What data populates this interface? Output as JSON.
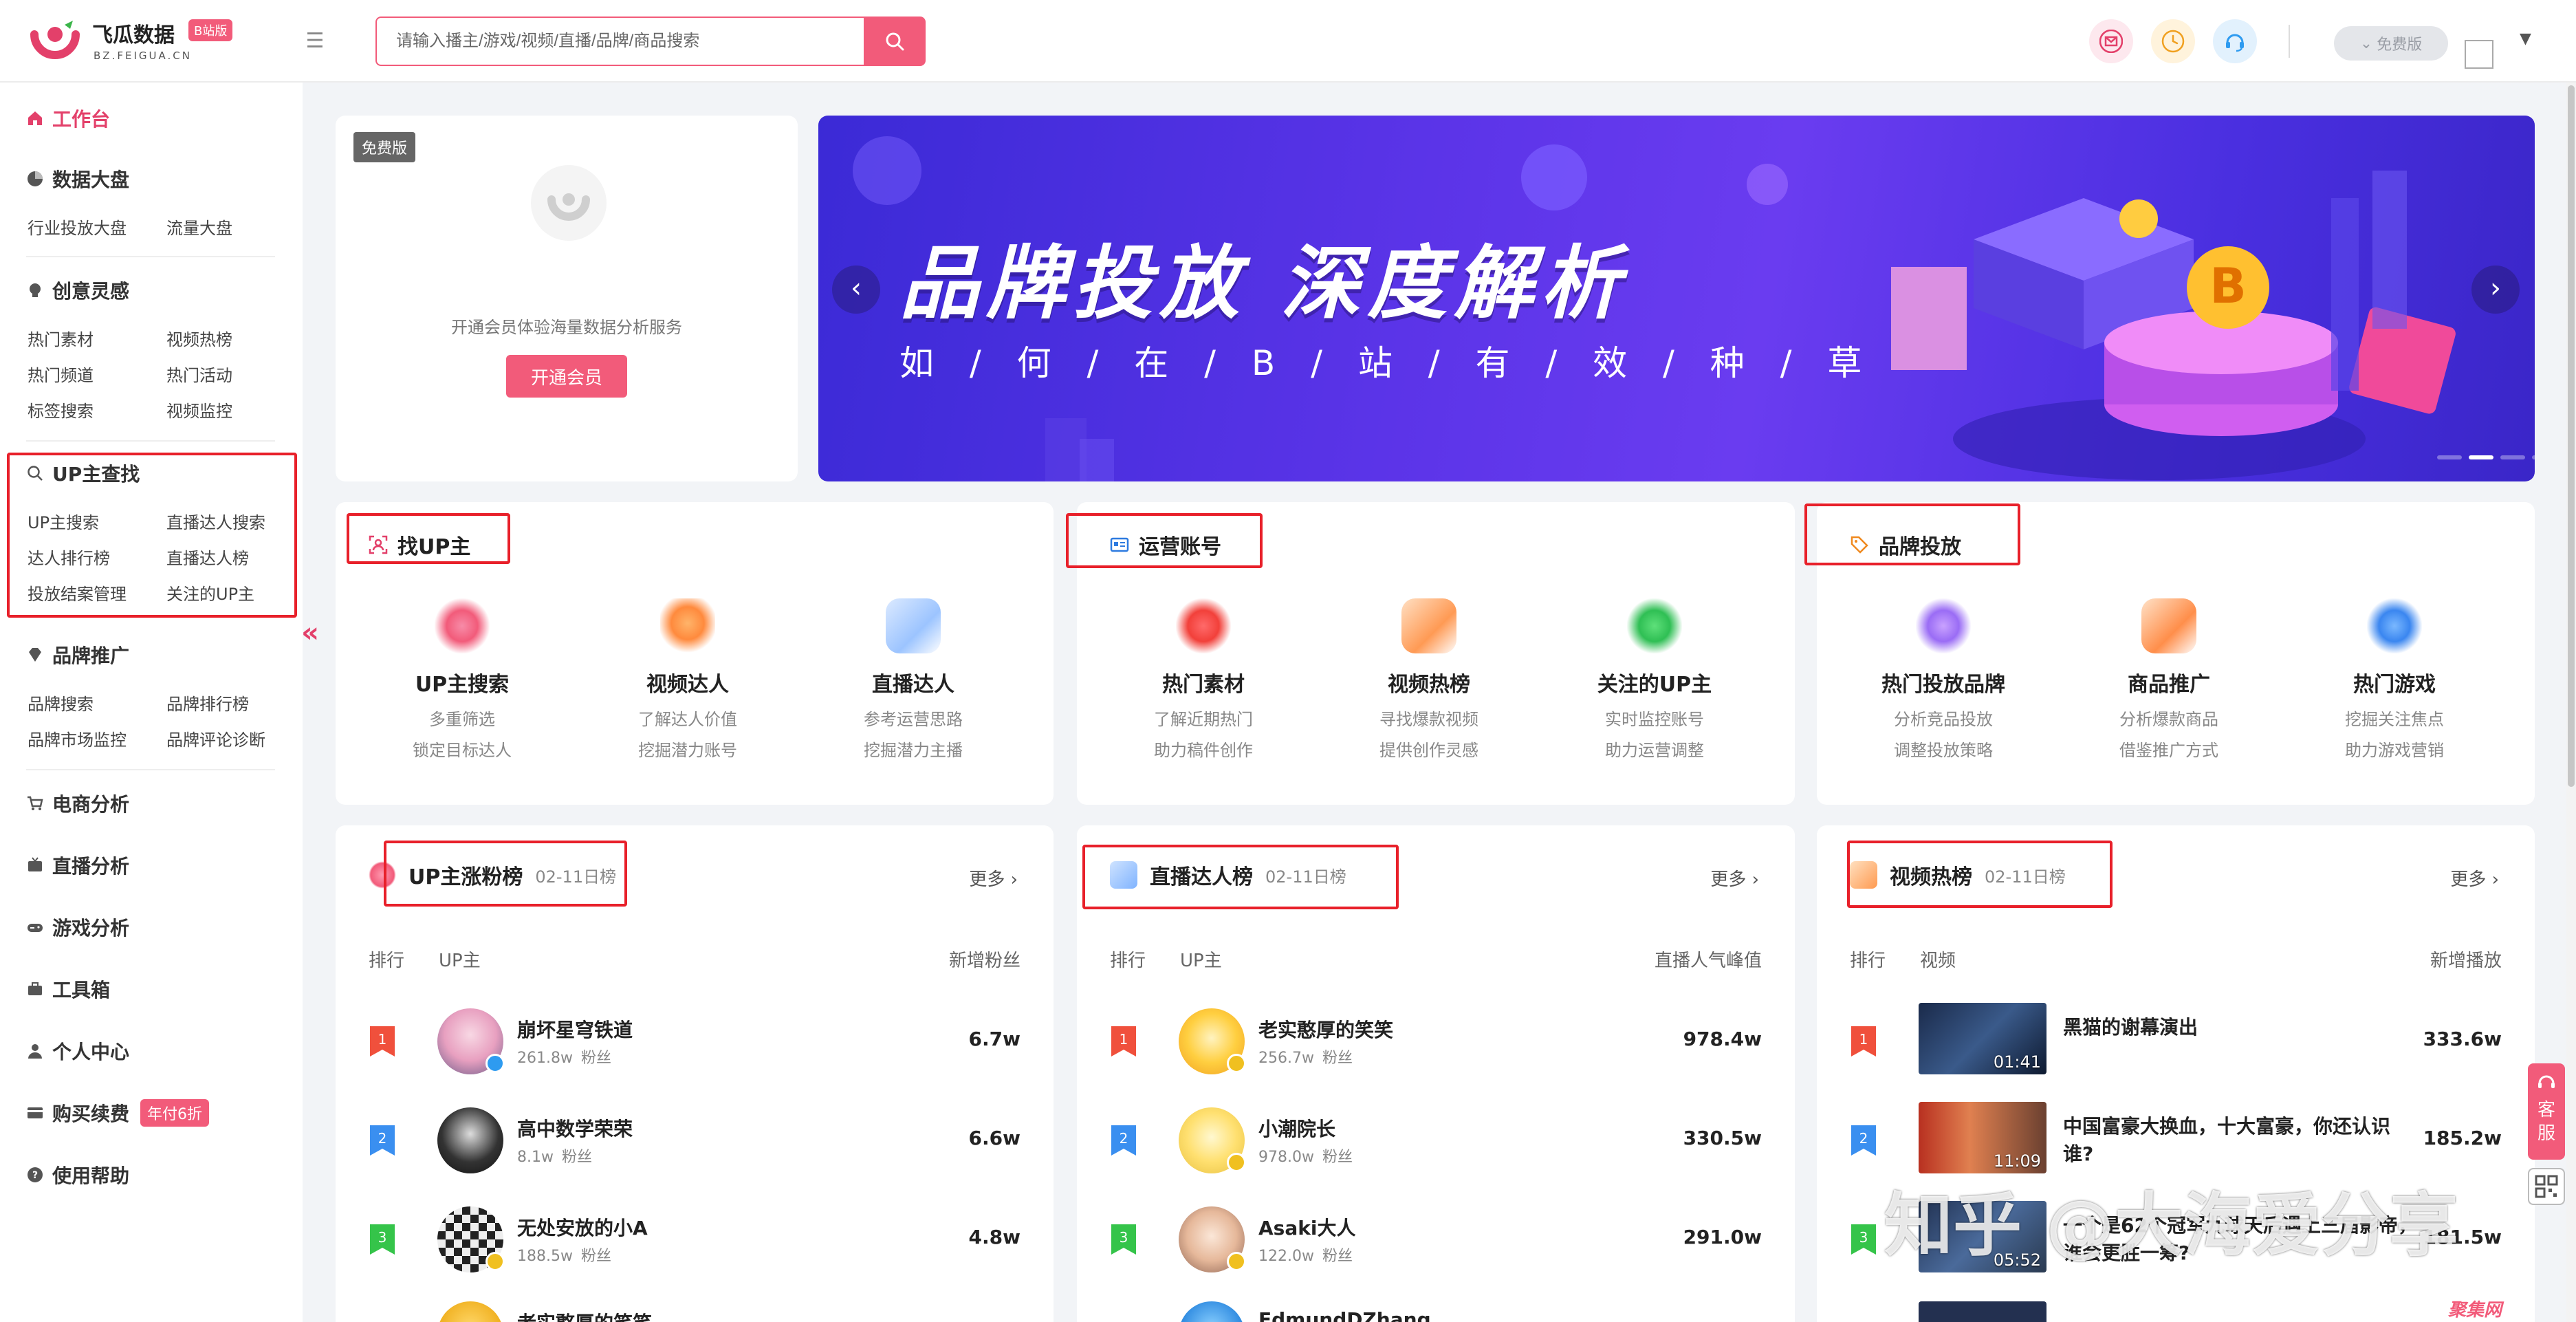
{
  "header": {
    "brand_name": "飞瓜数据",
    "brand_badge": "B站版",
    "brand_domain": "BZ.FEIGUA.CN",
    "search_placeholder": "请输入播主/游戏/视频/直播/品牌/商品搜索",
    "plan_label": "免费版",
    "icons": [
      "mail-icon",
      "clock-icon",
      "headset-icon"
    ],
    "icon_colors": [
      "#e3406a",
      "#f0a020",
      "#2e9bf0"
    ]
  },
  "sidebar": {
    "workbench": "工作台",
    "sections": [
      {
        "title": "数据大盘",
        "items": [
          "行业投放大盘",
          "流量大盘"
        ]
      },
      {
        "title": "创意灵感",
        "items": [
          "热门素材",
          "视频热榜",
          "热门频道",
          "热门活动",
          "标签搜索",
          "视频监控"
        ]
      },
      {
        "title": "UP主查找",
        "items": [
          "UP主搜索",
          "直播达人搜索",
          "达人排行榜",
          "直播达人榜",
          "投放结案管理",
          "关注的UP主"
        ]
      },
      {
        "title": "品牌推广",
        "items": [
          "品牌搜索",
          "品牌排行榜",
          "品牌市场监控",
          "品牌评论诊断"
        ]
      }
    ],
    "singles": [
      "电商分析",
      "直播分析",
      "游戏分析",
      "工具箱",
      "个人中心",
      "购买续费",
      "使用帮助"
    ],
    "sale_badge": "年付6折"
  },
  "member_card": {
    "tag": "免费版",
    "desc": "开通会员体验海量数据分析服务",
    "cta": "开通会员"
  },
  "banner": {
    "title": "品牌投放  深度解析",
    "subtitle": "如 / 何 / 在 / B / 站 / 有 / 效 / 种 / 草",
    "slide_index": 2,
    "slide_count": 4
  },
  "features": [
    {
      "title": "找UP主",
      "items": [
        {
          "name": "UP主搜索",
          "d1": "多重筛选",
          "d2": "锁定目标达人"
        },
        {
          "name": "视频达人",
          "d1": "了解达人价值",
          "d2": "挖掘潜力账号"
        },
        {
          "name": "直播达人",
          "d1": "参考运营思路",
          "d2": "挖掘潜力主播"
        }
      ]
    },
    {
      "title": "运营账号",
      "items": [
        {
          "name": "热门素材",
          "d1": "了解近期热门",
          "d2": "助力稿件创作"
        },
        {
          "name": "视频热榜",
          "d1": "寻找爆款视频",
          "d2": "提供创作灵感"
        },
        {
          "name": "关注的UP主",
          "d1": "实时监控账号",
          "d2": "助力运营调整"
        }
      ]
    },
    {
      "title": "品牌投放",
      "items": [
        {
          "name": "热门投放品牌",
          "d1": "分析竞品投放",
          "d2": "调整投放策略"
        },
        {
          "name": "商品推广",
          "d1": "分析爆款商品",
          "d2": "借鉴推广方式"
        },
        {
          "name": "热门游戏",
          "d1": "挖掘关注焦点",
          "d2": "助力游戏营销"
        }
      ]
    }
  ],
  "rankings": [
    {
      "title": "UP主涨粉榜",
      "date": "02-11日榜",
      "more": "更多",
      "cols": [
        "排行",
        "UP主",
        "新增粉丝"
      ],
      "rows": [
        {
          "name": "崩坏星穹铁道",
          "count": "261.8w",
          "unit": "粉丝",
          "value": "6.7w"
        },
        {
          "name": "高中数学荣荣",
          "count": "8.1w",
          "unit": "粉丝",
          "value": "6.6w"
        },
        {
          "name": "无处安放的小A",
          "count": "188.5w",
          "unit": "粉丝",
          "value": "4.8w"
        },
        {
          "name": "老实憨厚的笑笑"
        }
      ]
    },
    {
      "title": "直播达人榜",
      "date": "02-11日榜",
      "more": "更多",
      "cols": [
        "排行",
        "UP主",
        "直播人气峰值"
      ],
      "rows": [
        {
          "name": "老实憨厚的笑笑",
          "count": "256.7w",
          "unit": "粉丝",
          "value": "978.4w"
        },
        {
          "name": "小潮院长",
          "count": "978.0w",
          "unit": "粉丝",
          "value": "330.5w"
        },
        {
          "name": "Asaki大人",
          "count": "122.0w",
          "unit": "粉丝",
          "value": "291.0w"
        },
        {
          "name": "EdmundDZhang"
        }
      ]
    },
    {
      "title": "视频热榜",
      "date": "02-11日榜",
      "more": "更多",
      "cols": [
        "排行",
        "视频",
        "新增播放"
      ],
      "rows": [
        {
          "title": "黑猫的谢幕演出",
          "duration": "01:41",
          "value": "333.6w"
        },
        {
          "title": "中国富豪大换血，十大富豪，你还认识谁?",
          "duration": "11:09",
          "value": "185.2w"
        },
        {
          "title": "一个是62个冠军九球天后遇上三届影帝，谁会更胜一筹?",
          "duration": "05:52",
          "value": "181.5w"
        }
      ]
    }
  ],
  "float": {
    "service": "客服"
  },
  "watermark": "知乎 @大海爱分享",
  "watermark_small": "聚集网"
}
